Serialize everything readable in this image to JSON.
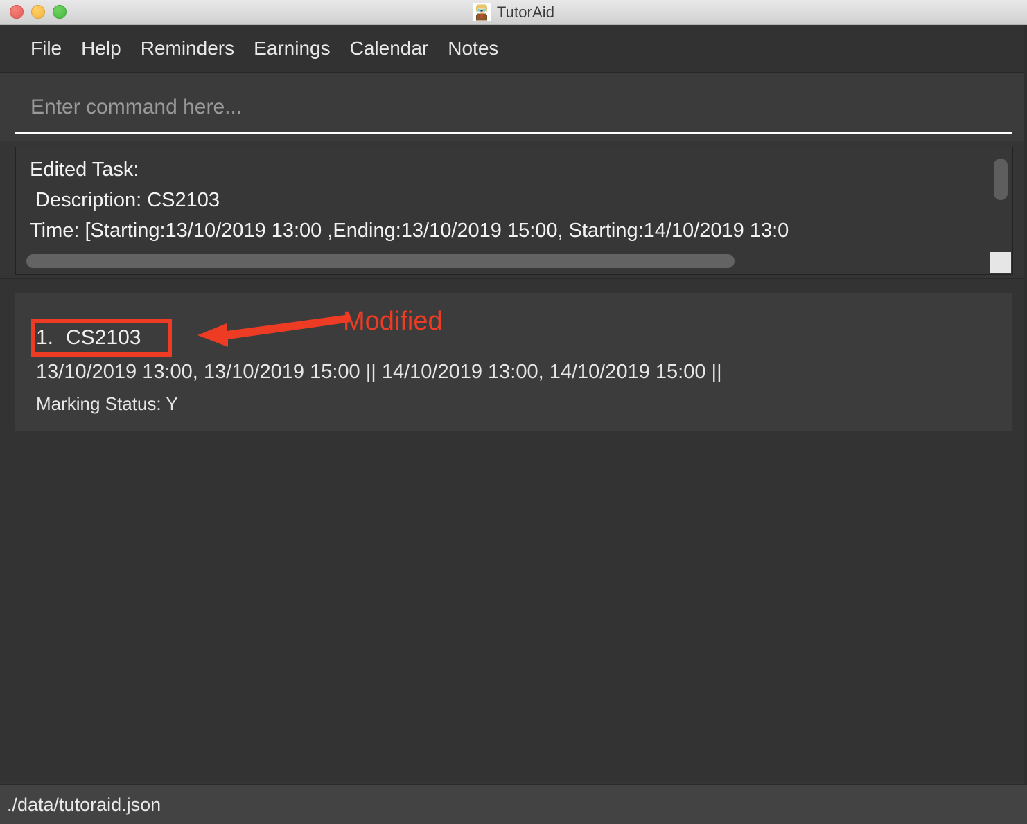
{
  "window": {
    "title": "TutorAid",
    "icon": "tutor-avatar-icon",
    "controls": {
      "close": "close-window",
      "minimize": "minimize-window",
      "maximize": "maximize-window"
    }
  },
  "menubar": {
    "items": [
      {
        "label": "File"
      },
      {
        "label": "Help"
      },
      {
        "label": "Reminders"
      },
      {
        "label": "Earnings"
      },
      {
        "label": "Calendar"
      },
      {
        "label": "Notes"
      }
    ]
  },
  "command": {
    "placeholder": "Enter command here...",
    "value": ""
  },
  "result": {
    "lines": [
      "Edited Task:",
      " Description: CS2103",
      "Time: [Starting:13/10/2019 13:00 ,Ending:13/10/2019 15:00, Starting:14/10/2019 13:0"
    ],
    "text": "Edited Task:\n Description: CS2103\nTime: [Starting:13/10/2019 13:00 ,Ending:13/10/2019 15:00, Starting:14/10/2019 13:0"
  },
  "task_list": {
    "items": [
      {
        "index": "1.",
        "description": "CS2103",
        "times": "13/10/2019 13:00, 13/10/2019 15:00 || 14/10/2019 13:00, 14/10/2019 15:00 ||",
        "marking_status": "Marking Status: Y"
      }
    ]
  },
  "annotation": {
    "label": "Modified",
    "color": "#ee3b24"
  },
  "status_bar": {
    "file_path": "./data/tutoraid.json"
  },
  "colors": {
    "titlebar": "#dcdcdc",
    "menubar": "#323232",
    "command_bg": "#3b3b3b",
    "result_bg": "#373737",
    "list_bg": "#333333",
    "card_bg": "#3c3c3c",
    "status_bg": "#434343",
    "text": "#f0f0f0",
    "placeholder": "#9a9a9a",
    "annotation": "#ee3b24"
  }
}
